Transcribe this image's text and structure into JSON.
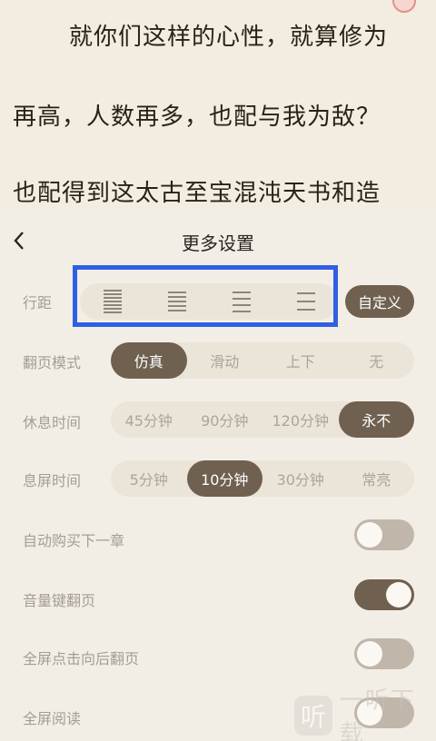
{
  "reader": {
    "lines": [
      "就你们这样的心性，就算修为",
      "再高，人数再多，也配与我为敌？",
      "也配得到这太古至宝混沌天书和造"
    ]
  },
  "settings": {
    "title": "更多设置",
    "back_icon": "chevron-left-icon",
    "line_spacing": {
      "label": "行距",
      "options": [
        "spacing-dense-icon",
        "spacing-compact-icon",
        "spacing-normal-icon",
        "spacing-loose-icon"
      ],
      "custom_label": "自定义"
    },
    "page_turn": {
      "label": "翻页模式",
      "options": [
        "仿真",
        "滑动",
        "上下",
        "无"
      ],
      "selected": "仿真"
    },
    "rest_time": {
      "label": "休息时间",
      "options": [
        "45分钟",
        "90分钟",
        "120分钟",
        "永不"
      ],
      "selected": "永不"
    },
    "screen_off": {
      "label": "息屏时间",
      "options": [
        "5分钟",
        "10分钟",
        "30分钟",
        "常亮"
      ],
      "selected": "10分钟"
    },
    "toggles": [
      {
        "label": "自动购买下一章",
        "on": false
      },
      {
        "label": "音量键翻页",
        "on": true
      },
      {
        "label": "全屏点击向后翻页",
        "on": false
      },
      {
        "label": "全屏阅读",
        "on": false
      }
    ]
  },
  "colors": {
    "accent": "#6f6050",
    "highlight_box": "#2f5fe3",
    "background": "#f3eee5"
  },
  "watermark": {
    "logo_glyph": "听",
    "text": "一听下载"
  }
}
